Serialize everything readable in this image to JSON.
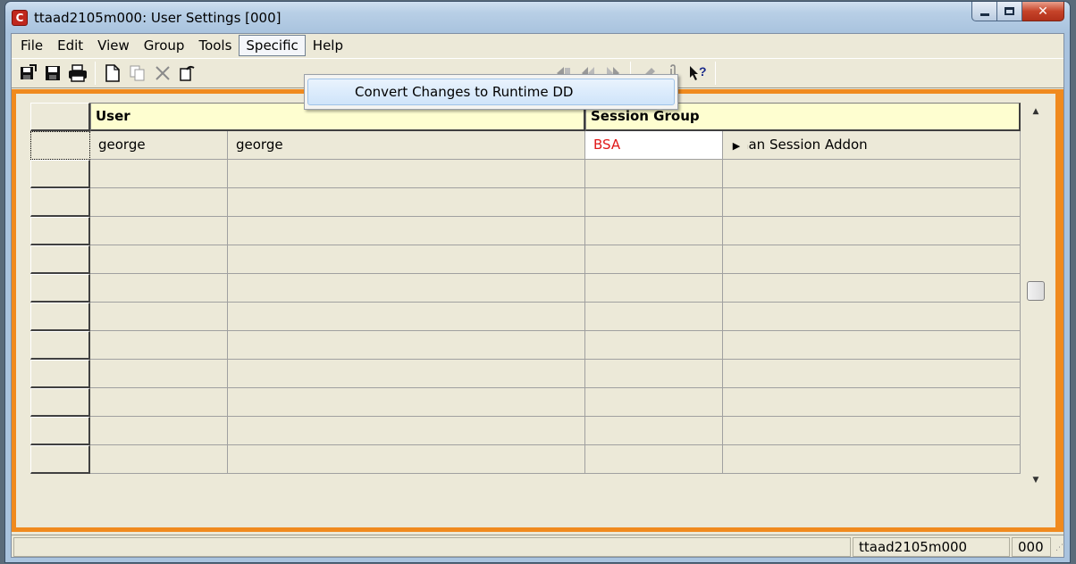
{
  "window": {
    "title": "ttaad2105m000: User Settings [000]",
    "app_icon_glyph": "C",
    "caption": {
      "minimize": "minimize-icon",
      "maximize": "maximize-icon",
      "close": "close-icon"
    }
  },
  "menubar": {
    "items": [
      {
        "label": "File"
      },
      {
        "label": "Edit"
      },
      {
        "label": "View"
      },
      {
        "label": "Group"
      },
      {
        "label": "Tools"
      },
      {
        "label": "Specific",
        "active": true
      },
      {
        "label": "Help"
      }
    ]
  },
  "toolbar": {
    "icons": [
      "save-and-exit-icon",
      "save-icon",
      "print-icon",
      "new-icon",
      "copy-icon",
      "delete-icon",
      "undo-icon",
      "first-record-icon",
      "previous-record-icon",
      "next-record-icon",
      "last-record-icon",
      "text-icon",
      "attachment-icon",
      "whats-this-help-icon"
    ]
  },
  "dropdown": {
    "items": [
      {
        "label": "Convert Changes to Runtime DD"
      }
    ]
  },
  "grid": {
    "headers": {
      "user": "User",
      "session_group": "Session Group"
    },
    "rows": [
      {
        "user_code": "george",
        "user_name": "george",
        "group_code": "BSA",
        "group_desc": "Baan Session Addon"
      },
      {
        "user_code": "",
        "user_name": "",
        "group_code": "",
        "group_desc": ""
      },
      {
        "user_code": "",
        "user_name": "",
        "group_code": "",
        "group_desc": ""
      },
      {
        "user_code": "",
        "user_name": "",
        "group_code": "",
        "group_desc": ""
      },
      {
        "user_code": "",
        "user_name": "",
        "group_code": "",
        "group_desc": ""
      },
      {
        "user_code": "",
        "user_name": "",
        "group_code": "",
        "group_desc": ""
      },
      {
        "user_code": "",
        "user_name": "",
        "group_code": "",
        "group_desc": ""
      },
      {
        "user_code": "",
        "user_name": "",
        "group_code": "",
        "group_desc": ""
      },
      {
        "user_code": "",
        "user_name": "",
        "group_code": "",
        "group_desc": ""
      },
      {
        "user_code": "",
        "user_name": "",
        "group_code": "",
        "group_desc": ""
      },
      {
        "user_code": "",
        "user_name": "",
        "group_code": "",
        "group_desc": ""
      },
      {
        "user_code": "",
        "user_name": "",
        "group_code": "",
        "group_desc": ""
      }
    ],
    "zoom_icon": "zoom-arrow-icon"
  },
  "statusbar": {
    "session_code": "ttaad2105m000",
    "company": "000"
  },
  "colors": {
    "frame_accent": "#f08a1e",
    "header_bg": "#fefed0",
    "code_text": "#e01818"
  }
}
